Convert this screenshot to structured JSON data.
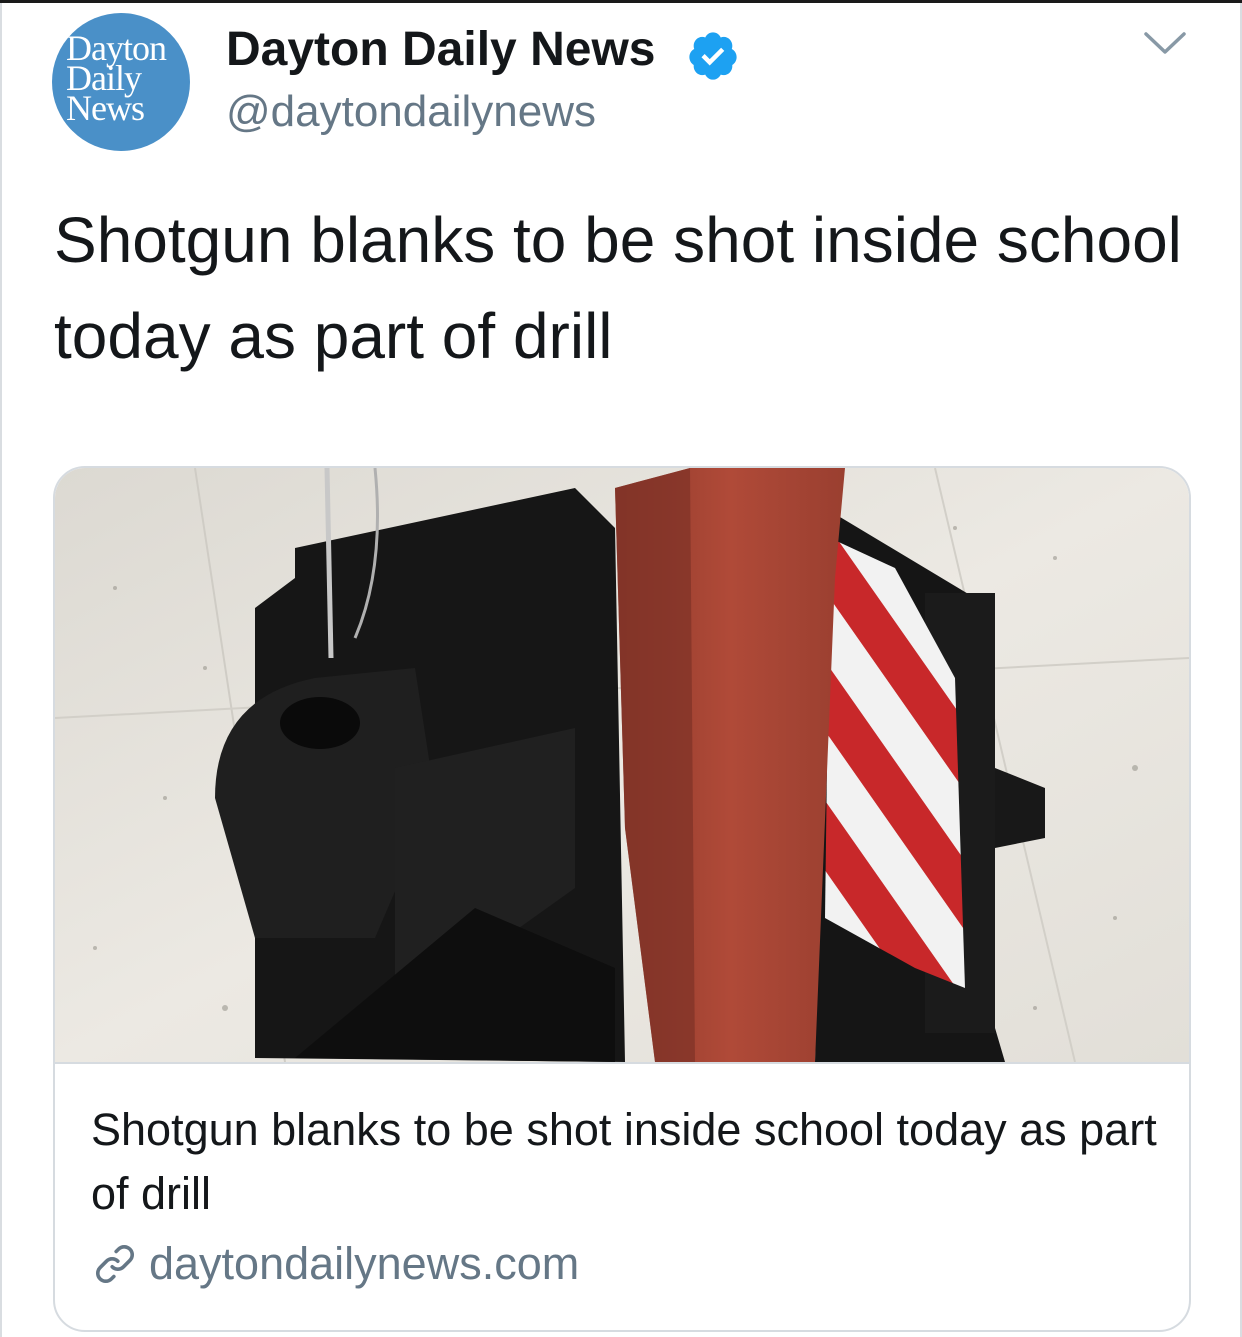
{
  "tweet": {
    "author": {
      "display_name": "Dayton Daily News",
      "handle": "@daytondailynews",
      "verified": true,
      "avatar_logo_lines": [
        "Dayton",
        "Daily",
        "News"
      ],
      "avatar_color": "#4a90c8"
    },
    "text": "Shotgun blanks to be shot inside school today as part of drill",
    "menu_icon": "chevron-down-icon"
  },
  "card": {
    "image_description": "black-and-red barricade stand on tile floor",
    "title": "Shotgun blanks to be shot inside school today as part of drill",
    "domain": "daytondailynews.com",
    "link_icon": "link-icon"
  },
  "colors": {
    "text_primary": "#14171a",
    "text_secondary": "#657786",
    "verified_blue": "#1da1f2",
    "border": "#d6dbe0"
  }
}
